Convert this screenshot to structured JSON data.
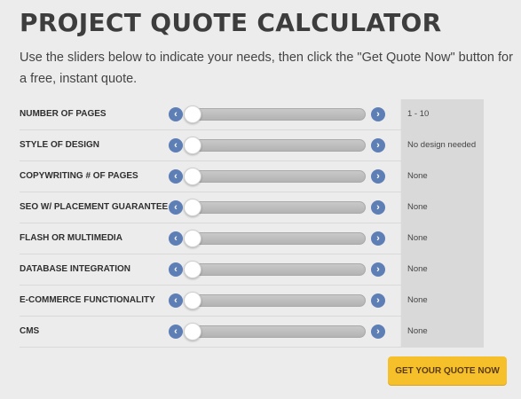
{
  "page": {
    "title": "PROJECT QUOTE CALCULATOR",
    "intro": "Use the sliders below to indicate your needs, then click the \"Get Quote Now\" button for a free, instant quote."
  },
  "colors": {
    "background": "#ececec",
    "arrow": "#5d7fb5",
    "value_column": "#d9d9d9",
    "quote_button": "#f6c02a"
  },
  "sliders": [
    {
      "label": "NUMBER OF PAGES",
      "value": "1 - 10",
      "level": 0
    },
    {
      "label": "STYLE OF DESIGN",
      "value": "No design needed",
      "level": 0
    },
    {
      "label": "COPYWRITING # OF PAGES",
      "value": "None",
      "level": 0
    },
    {
      "label": "SEO W/ PLACEMENT GUARANTEE",
      "value": "None",
      "level": 0
    },
    {
      "label": "FLASH OR MULTIMEDIA",
      "value": "None",
      "level": 0
    },
    {
      "label": "DATABASE INTEGRATION",
      "value": "None",
      "level": 0
    },
    {
      "label": "E-COMMERCE FUNCTIONALITY",
      "value": "None",
      "level": 0
    },
    {
      "label": "CMS",
      "value": "None",
      "level": 0
    }
  ],
  "icons": {
    "decrease": "chevron-left-icon",
    "increase": "chevron-right-icon"
  },
  "actions": {
    "quote_button_label": "GET YOUR QUOTE NOW"
  }
}
